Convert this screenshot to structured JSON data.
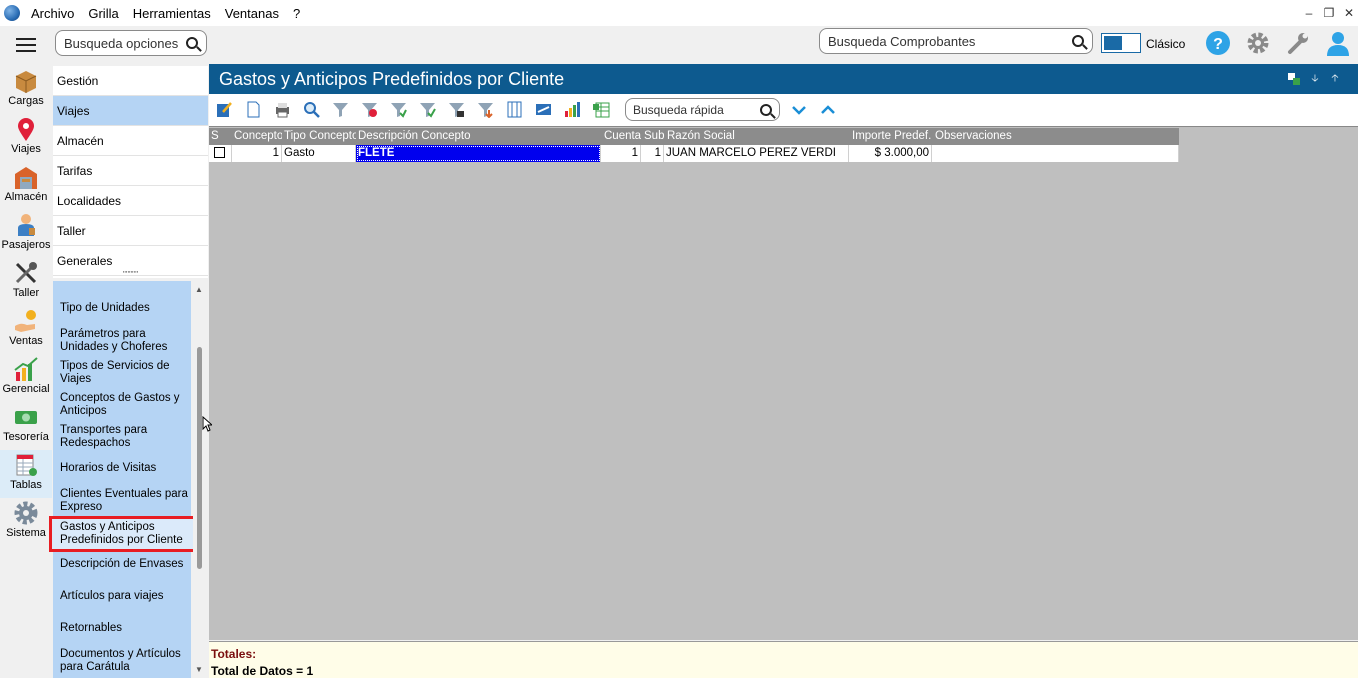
{
  "menu": {
    "items": [
      "Archivo",
      "Grilla",
      "Herramientas",
      "Ventanas",
      "?"
    ]
  },
  "topbar": {
    "search_options_placeholder": "Busqueda opciones",
    "search_vouchers_placeholder": "Busqueda Comprobantes",
    "classic_label": "Clásico"
  },
  "rail": {
    "items": [
      "Cargas",
      "Viajes",
      "Almacén",
      "Pasajeros",
      "Taller",
      "Ventas",
      "Gerencial",
      "Tesorería",
      "Tablas",
      "Sistema"
    ],
    "active": "Tablas"
  },
  "categories": {
    "items": [
      "Gestión",
      "Viajes",
      "Almacén",
      "Tarifas",
      "Localidades",
      "Taller",
      "Generales"
    ],
    "selected": "Viajes"
  },
  "subitems": {
    "items": [
      "Tipo de Unidades",
      "Parámetros para Unidades y Choferes",
      "Tipos de Servicios de Viajes",
      "Conceptos de Gastos y Anticipos",
      "Transportes para Redespachos",
      "Horarios de Visitas",
      "Clientes Eventuales para Expreso",
      "Gastos y Anticipos Predefinidos por Cliente",
      "Descripción de Envases",
      "Artículos para viajes",
      "Retornables",
      "Documentos y Artículos para Carátula"
    ],
    "highlighted": "Gastos y Anticipos Predefinidos por Cliente"
  },
  "main": {
    "title": "Gastos y Anticipos Predefinidos por Cliente",
    "quick_search_placeholder": "Busqueda rápida"
  },
  "grid": {
    "columns": [
      "S",
      "Concepto",
      "Tipo Concepto",
      "Descripción Concepto",
      "Cuenta",
      "Sub",
      "Razón Social",
      "Importe Predef.",
      "Observaciones"
    ],
    "rows": [
      {
        "s": "",
        "concepto": "1",
        "tipo": "Gasto",
        "descripcion": "FLETE",
        "cuenta": "1",
        "sub": "1",
        "razon": "JUAN MARCELO PEREZ VERDI",
        "importe": "$ 3.000,00",
        "obs": ""
      }
    ]
  },
  "totals": {
    "label": "Totales:",
    "count_text": "Total de Datos = 1"
  },
  "colors": {
    "title_bar": "#0d5a8f",
    "selection_blue": "#b5d4f4",
    "highlight_red": "#e81d23",
    "cell_selected": "#0000ee"
  }
}
